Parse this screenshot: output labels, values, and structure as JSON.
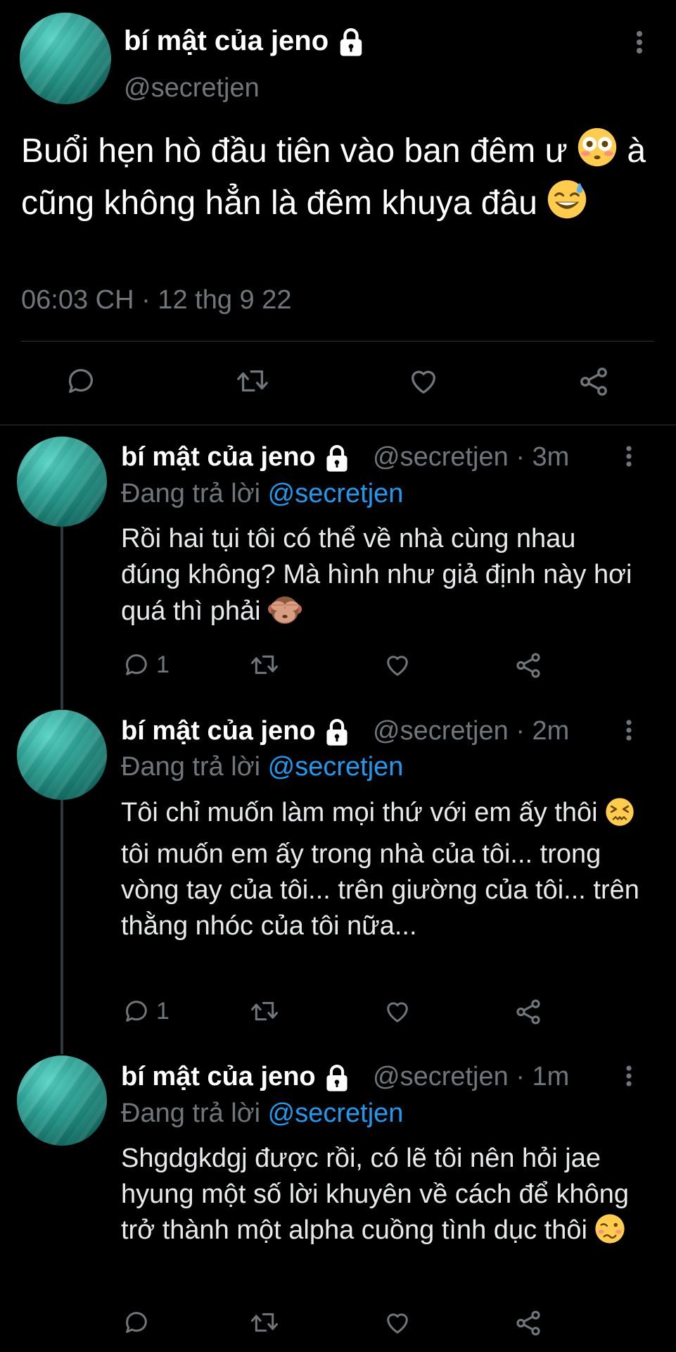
{
  "main_tweet": {
    "display_name": "bí mật của jeno",
    "handle": "@secretjen",
    "text_part1": "Buổi hẹn hò đầu tiên vào ban đêm ư",
    "text_part2": "à cũng không hẳn là đêm khuya",
    "text_part3": "đâu",
    "emoji_1": "flushed-face",
    "emoji_2": "grinning-face-with-sweat",
    "timestamp": "06:03 CH · 12 thg 9 22"
  },
  "replies": [
    {
      "display_name": "bí mật của jeno",
      "handle": "@secretjen · 3m",
      "replying_prefix": "Đang trả lời",
      "replying_mention": "@secretjen",
      "text": "Rồi hai tụi tôi có thể về nhà cùng nhau đúng không? Mà hình như giả định này hơi quá thì phải",
      "emoji": "see-no-evil-monkey",
      "reply_count": "1"
    },
    {
      "display_name": "bí mật của jeno",
      "handle": "@secretjen · 2m",
      "replying_prefix": "Đang trả lời",
      "replying_mention": "@secretjen",
      "text_part1": "Tôi chỉ muốn làm mọi thứ với em ấy thôi",
      "text_part2": "tôi muốn em ấy trong nhà của tôi... trong vòng tay của tôi... trên giường của tôi... trên thằng nhóc của tôi nữa...",
      "emoji": "confounded-face",
      "reply_count": "1"
    },
    {
      "display_name": "bí mật của jeno",
      "handle": "@secretjen · 1m",
      "replying_prefix": "Đang trả lời",
      "replying_mention": "@secretjen",
      "text": "Shgdgkdgj được rồi, có lẽ tôi nên hỏi jae hyung một số lời khuyên về cách để không trở thành một alpha cuồng tình dục thôi",
      "emoji": "woozy-face",
      "reply_count": ""
    }
  ],
  "icons": {
    "reply": "reply-icon",
    "retweet": "retweet-icon",
    "like": "like-icon",
    "share": "share-icon",
    "lock": "lock-icon",
    "more": "more-options-icon"
  },
  "colors": {
    "background": "#000000",
    "text": "#e7e9ea",
    "secondary": "#71767b",
    "accent": "#1d9bf0",
    "avatar": "#1aa596"
  }
}
